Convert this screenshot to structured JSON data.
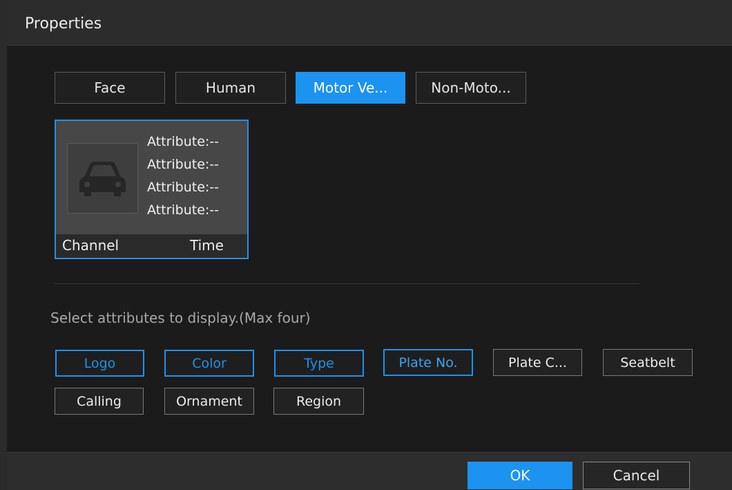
{
  "window": {
    "title": "Properties"
  },
  "tabs": [
    {
      "label": "Face",
      "active": false
    },
    {
      "label": "Human",
      "active": false
    },
    {
      "label": "Motor Ve...",
      "active": true
    },
    {
      "label": "Non-Moto...",
      "active": false
    }
  ],
  "preview": {
    "icon": "car-icon",
    "attributes": [
      "Attribute:--",
      "Attribute:--",
      "Attribute:--",
      "Attribute:--"
    ],
    "channel_label": "Channel",
    "time_label": "Time"
  },
  "hint": "Select attributes to display.(Max four)",
  "attribute_options": [
    {
      "label": "Logo",
      "selected": true
    },
    {
      "label": "Color",
      "selected": true
    },
    {
      "label": "Type",
      "selected": true
    },
    {
      "label": "Plate No.",
      "selected": true
    },
    {
      "label": "Plate C...",
      "selected": false
    },
    {
      "label": "Seatbelt",
      "selected": false
    },
    {
      "label": "Calling",
      "selected": false
    },
    {
      "label": "Ornament",
      "selected": false
    },
    {
      "label": "Region",
      "selected": false
    }
  ],
  "footer": {
    "ok_label": "OK",
    "cancel_label": "Cancel"
  },
  "colors": {
    "accent": "#1c93f0",
    "background": "#1b1b1b"
  }
}
